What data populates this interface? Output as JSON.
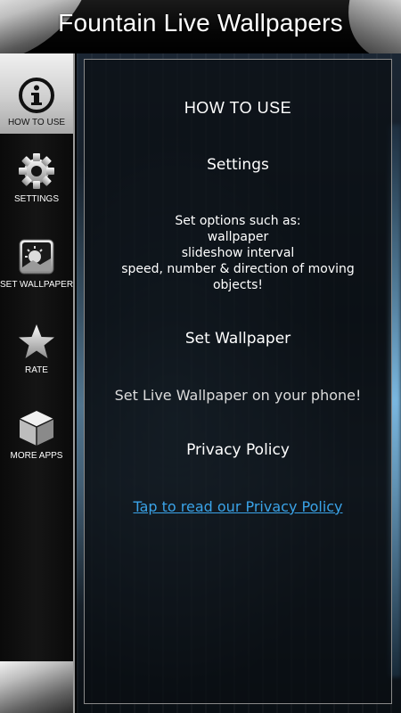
{
  "header": {
    "title": "Fountain Live Wallpapers"
  },
  "sidebar": {
    "items": [
      {
        "label": "HOW TO USE",
        "icon": "info-icon",
        "active": true
      },
      {
        "label": "SETTINGS",
        "icon": "gear-icon",
        "active": false
      },
      {
        "label": "SET WALLPAPER",
        "icon": "wallpaper-icon",
        "active": false
      },
      {
        "label": "RATE",
        "icon": "star-icon",
        "active": false
      },
      {
        "label": "MORE APPS",
        "icon": "cube-icon",
        "active": false
      }
    ]
  },
  "content": {
    "heading": "HOW TO USE",
    "settings_title": "Settings",
    "settings_lines": [
      "Set options such as:",
      "wallpaper",
      "slideshow interval",
      "speed, number & direction of moving",
      "objects!"
    ],
    "set_wallpaper_title": "Set Wallpaper",
    "set_wallpaper_text": "Set Live Wallpaper on your phone!",
    "privacy_title": "Privacy Policy",
    "privacy_link": "Tap to read our Privacy Policy"
  },
  "colors": {
    "link": "#3aa3e8",
    "active_tab": "#cfcfcf",
    "background": "#000000"
  }
}
